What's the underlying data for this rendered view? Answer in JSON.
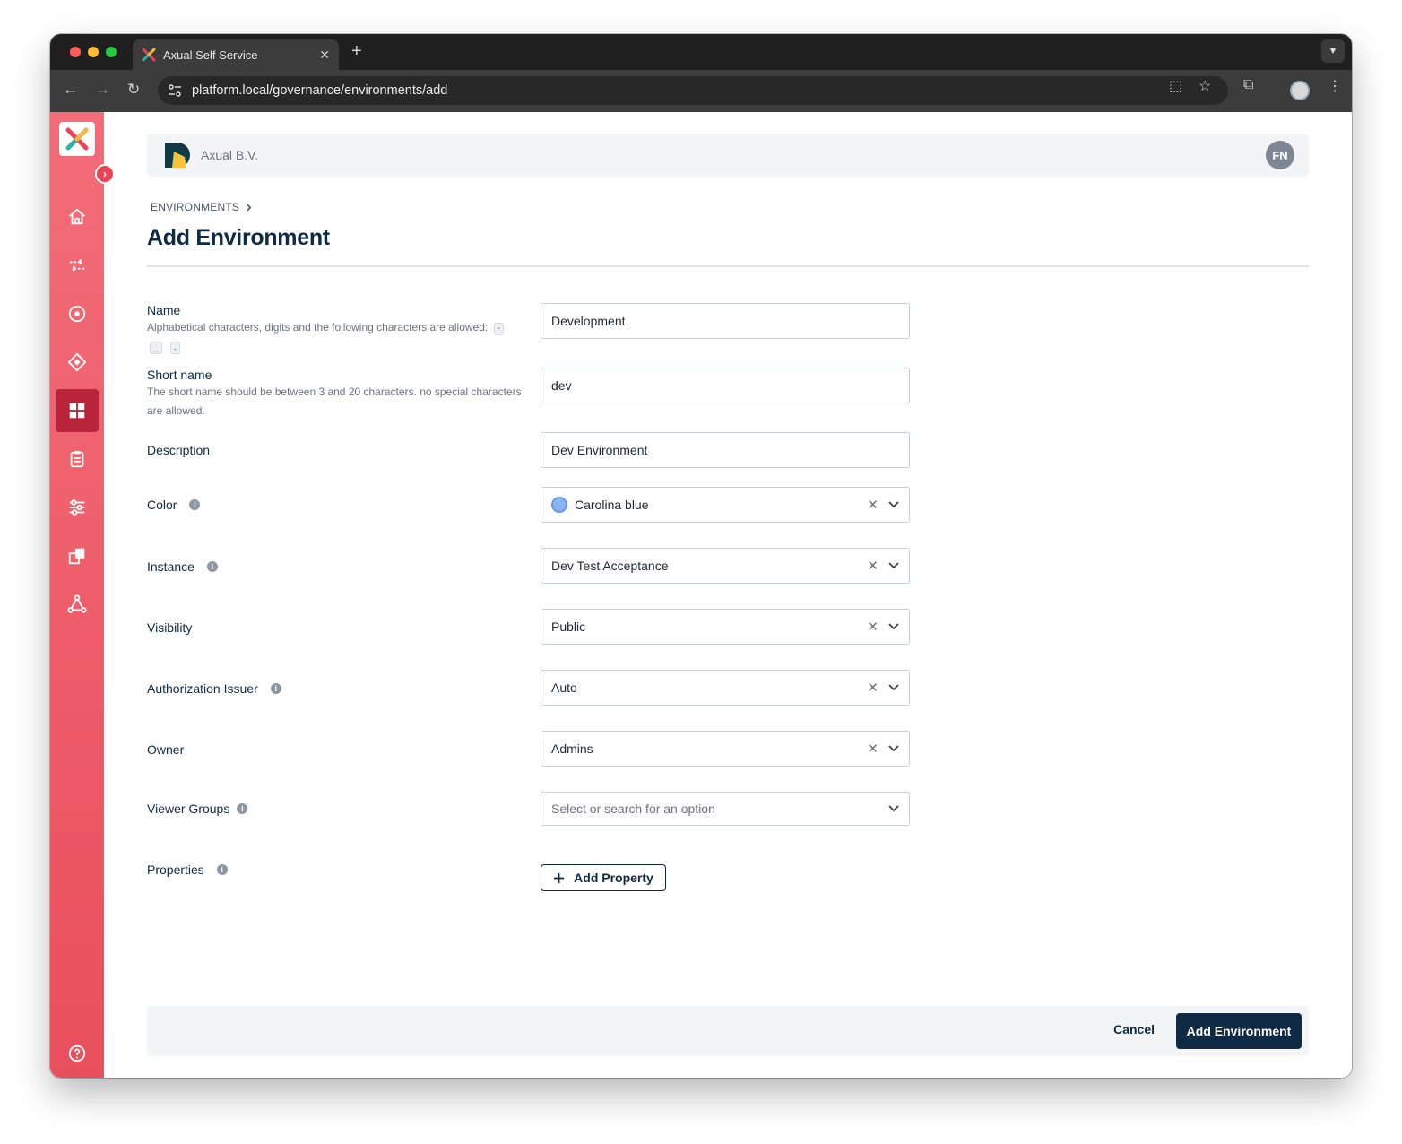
{
  "browser": {
    "tab_title": "Axual Self Service",
    "url": "platform.local/governance/environments/add"
  },
  "org": {
    "name": "Axual B.V.",
    "user_initials": "FN"
  },
  "breadcrumb": {
    "item": "ENVIRONMENTS"
  },
  "page": {
    "title": "Add Environment"
  },
  "form": {
    "name": {
      "label": "Name",
      "help": "Alphabetical characters, digits and the following characters are allowed:",
      "allowed_chars": [
        "-",
        "_",
        "."
      ],
      "value": "Development"
    },
    "short_name": {
      "label": "Short name",
      "help": "The short name should be between 3 and 20 characters. no special characters are allowed.",
      "value": "dev"
    },
    "description": {
      "label": "Description",
      "value": "Dev Environment"
    },
    "color": {
      "label": "Color",
      "value": "Carolina blue"
    },
    "instance": {
      "label": "Instance",
      "value": "Dev Test Acceptance"
    },
    "visibility": {
      "label": "Visibility",
      "value": "Public"
    },
    "authorization_issuer": {
      "label": "Authorization Issuer",
      "value": "Auto"
    },
    "owner": {
      "label": "Owner",
      "value": "Admins"
    },
    "viewer_groups": {
      "label": "Viewer Groups",
      "placeholder": "Select or search for an option"
    },
    "properties": {
      "label": "Properties",
      "add_label": "Add Property"
    }
  },
  "actions": {
    "cancel_label": "Cancel",
    "submit_label": "Add Environment"
  },
  "colors": {
    "sidebar": "#f26d78",
    "primary": "#0f2a44",
    "swatch": "#8cb4f4"
  }
}
